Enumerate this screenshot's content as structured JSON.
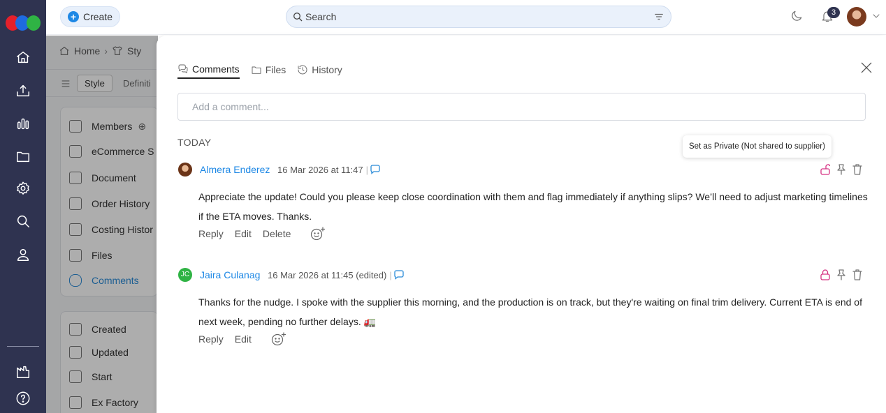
{
  "topbar": {
    "create_label": "Create",
    "search_placeholder": "Search",
    "notification_count": "3"
  },
  "background": {
    "breadcrumb": [
      "Home",
      "Sty"
    ],
    "tabs": [
      "Style",
      "Definiti"
    ],
    "section1": [
      "Members",
      "eCommerce S",
      "Document",
      "Order History",
      "Costing Histor",
      "Files",
      "Comments"
    ],
    "section2": [
      "Created",
      "Updated",
      "Start",
      "Ex Factory"
    ]
  },
  "drawer": {
    "tabs": [
      {
        "label": "Comments",
        "icon": "chat-icon"
      },
      {
        "label": "Files",
        "icon": "folder-icon"
      },
      {
        "label": "History",
        "icon": "history-icon"
      }
    ],
    "comment_placeholder": "Add a comment...",
    "group_label": "TODAY",
    "tooltip": "Set as Private (Not shared to supplier)",
    "comments": [
      {
        "author": "Almera Enderez",
        "timestamp": "16 Mar 2026 at 11:47",
        "text": "Appreciate the update! Could you please keep close coordination with them and flag immediately if anything slips? We’ll need to adjust marketing timelines if the ETA moves. Thanks.",
        "actions": [
          "Reply",
          "Edit",
          "Delete"
        ]
      },
      {
        "author": "Jaira Culanag",
        "initials": "JC",
        "timestamp": "16 Mar 2026 at 11:45 (edited)",
        "text": "Thanks for the nudge. I spoke with the supplier this morning, and the production is on track, but they're waiting on final trim delivery. Current ETA is end of next week, pending no further delays. 🚛",
        "actions": [
          "Reply",
          "Edit"
        ]
      }
    ]
  },
  "colors": {
    "rail": "#2f3350",
    "accent": "#1e88e5",
    "private": "#d63384"
  }
}
